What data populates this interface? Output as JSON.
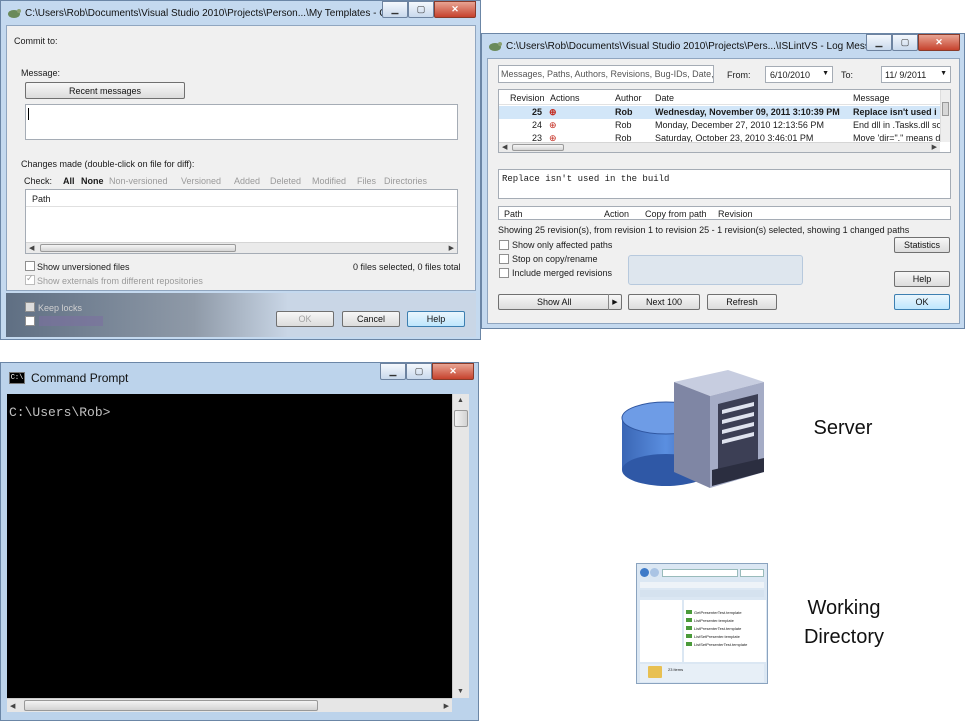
{
  "commit_window": {
    "title": "C:\\Users\\Rob\\Documents\\Visual Studio 2010\\Projects\\Person...\\My Templates - Com...",
    "commit_to_label": "Commit to:",
    "message_label": "Message:",
    "recent_messages_button": "Recent messages",
    "changes_label": "Changes made (double-click on file for diff):",
    "check_label": "Check:",
    "filters": [
      "All",
      "None",
      "Non-versioned",
      "Versioned",
      "Added",
      "Deleted",
      "Modified",
      "Files",
      "Directories"
    ],
    "path_header": "Path",
    "show_unversioned": "Show unversioned files",
    "show_externals": "Show externals from different repositories",
    "files_selected": "0 files selected, 0 files total",
    "keep_locks": "Keep locks",
    "ok_button": "OK",
    "cancel_button": "Cancel",
    "help_button": "Help"
  },
  "log_window": {
    "title": "C:\\Users\\Rob\\Documents\\Visual Studio 2010\\Projects\\Pers...\\ISLintVS - Log Messages - To...",
    "search_placeholder": "Messages, Paths, Authors, Revisions, Bug-IDs, Date, Da",
    "from_label": "From:",
    "from_date": "6/10/2010",
    "to_label": "To:",
    "to_date": "11/ 9/2011",
    "columns": [
      "Revision",
      "Actions",
      "Author",
      "Date",
      "Message"
    ],
    "rows": [
      {
        "revision": "25",
        "author": "Rob",
        "date": "Wednesday, November 09, 2011 3:10:39 PM",
        "message": "Replace isn't used i"
      },
      {
        "revision": "24",
        "author": "Rob",
        "date": "Monday, December 27, 2010 12:13:56 PM",
        "message": "End dll in .Tasks.dll so f"
      },
      {
        "revision": "23",
        "author": "Rob",
        "date": "Saturday, October 23, 2010 3:46:01 PM",
        "message": "Move 'dir=\".\" means dll"
      }
    ],
    "message_text": "Replace isn't used in the build",
    "path_columns": [
      "Path",
      "Action",
      "Copy from path",
      "Revision"
    ],
    "status_text": "Showing 25 revision(s), from revision 1 to revision 25 - 1 revision(s) selected, showing 1 changed paths",
    "options": [
      "Show only affected paths",
      "Stop on copy/rename",
      "Include merged revisions"
    ],
    "statistics_button": "Statistics",
    "help_button": "Help",
    "show_all_button": "Show All",
    "next_button": "Next 100",
    "refresh_button": "Refresh",
    "ok_button": "OK"
  },
  "cmd_window": {
    "title": "Command Prompt",
    "icon_text": "C:\\",
    "prompt": "C:\\Users\\Rob>"
  },
  "diagram": {
    "server_label": "Server",
    "working_label_line1": "Working",
    "working_label_line2": "Directory",
    "explorer_thumb_items": [
      "GetPresenterTest.template",
      "ListPresenter.template",
      "ListPresenterTest.template",
      "ListSetPresenter.template",
      "ListSetPresenterTest.template"
    ],
    "explorer_thumb_count": "23 items"
  }
}
